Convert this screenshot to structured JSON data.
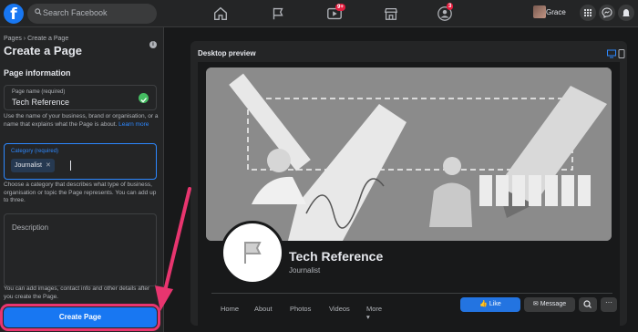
{
  "topbar": {
    "search_placeholder": "Search Facebook",
    "watch_badge": "9+",
    "groups_badge": "3",
    "user_name": "Grace"
  },
  "left_panel": {
    "breadcrumb": "Pages › Create a Page",
    "title": "Create a Page",
    "section_title": "Page information",
    "page_name_label": "Page name (required)",
    "page_name_value": "Tech Reference",
    "page_name_help": "Use the name of your business, brand or organisation, or a name that explains what the Page is about.",
    "learn_more": "Learn more",
    "category_label": "Category (required)",
    "category_chip": "Journalist",
    "category_help": "Choose a category that describes what type of business, organisation or topic the Page represents. You can add up to three.",
    "description_label": "Description",
    "bottom_help": "You can add images, contact info and other details after you create the Page.",
    "create_button": "Create Page"
  },
  "preview": {
    "label": "Desktop preview",
    "page_title": "Tech Reference",
    "page_category": "Journalist",
    "tabs": [
      "Home",
      "About",
      "Photos",
      "Videos",
      "More"
    ],
    "like_label": "Like",
    "message_label": "Message",
    "more_dots": "···"
  },
  "colors": {
    "accent": "#1877f2",
    "highlight_arrow": "#e8356f",
    "background": "#18191a",
    "panel": "#242526"
  }
}
